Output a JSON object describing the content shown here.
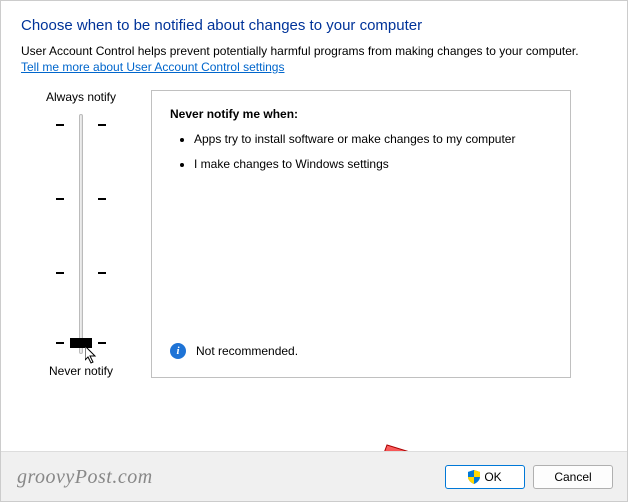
{
  "title": "Choose when to be notified about changes to your computer",
  "description": "User Account Control helps prevent potentially harmful programs from making changes to your computer.",
  "link": "Tell me more about User Account Control settings",
  "slider": {
    "top_label": "Always notify",
    "bottom_label": "Never notify",
    "value": 0,
    "max": 3
  },
  "panel": {
    "heading": "Never notify me when:",
    "bullets": [
      "Apps try to install software or make changes to my computer",
      "I make changes to Windows settings"
    ],
    "status": "Not recommended."
  },
  "buttons": {
    "ok": "OK",
    "cancel": "Cancel"
  },
  "watermark": "groovyPost.com"
}
